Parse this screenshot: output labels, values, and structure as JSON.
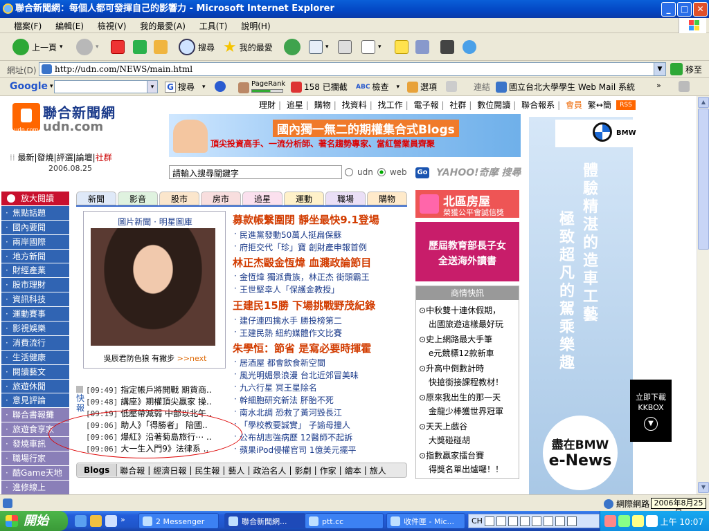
{
  "window": {
    "title": "聯合新聞網：每個人都可發揮自己的影響力 - Microsoft Internet Explorer",
    "controls": {
      "minimize": "_",
      "maximize": "□",
      "close": "✕"
    }
  },
  "menu": [
    "檔案(F)",
    "編輯(E)",
    "檢視(V)",
    "我的最愛(A)",
    "工具(T)",
    "說明(H)"
  ],
  "toolbar": {
    "back": "上一頁",
    "search": "搜尋",
    "favorites": "我的最愛"
  },
  "address": {
    "label": "網址(D)",
    "url": "http://udn.com/NEWS/main.html",
    "go": "移至"
  },
  "googlebar": {
    "brand": "Google",
    "search": "搜尋",
    "pagerank": "PageRank",
    "blocked": "158 已攔截",
    "check": "檢查",
    "options": "選項",
    "links": "連結",
    "link1": "國立台北大學學生 Web Mail 系統"
  },
  "page": {
    "logo_cn": "聯合新聞網",
    "logo_en": "udn.com",
    "logo_small": "udn.com",
    "toplinks": [
      "理財",
      "追星",
      "購物",
      "找資料",
      "找工作",
      "電子報",
      "社群",
      "數位閱讀",
      "聯合報系",
      "會員",
      "繁↔簡"
    ],
    "rss": "RSS",
    "banner": {
      "title": "國內獨一無二的期權集合式Blogs",
      "subtitle": "頂尖投資高手、一流分析師、著名趨勢專家、當紅營業員齊聚"
    },
    "quicknav": [
      "最新",
      "發燒",
      "評選",
      "論壇",
      "社群"
    ],
    "date": "2006.08.25",
    "search_value": "請輸入搜尋關鍵字",
    "radio_udn": "udn",
    "radio_web": "web",
    "go": "Go",
    "yahoo": "YAHOO!奇摩 搜尋",
    "sidebar": [
      "放大閱讀",
      "焦點話題",
      "國內要聞",
      "兩岸國際",
      "地方新聞",
      "財經產業",
      "股市理財",
      "資訊科技",
      "運動賽事",
      "影視娛樂",
      "消費流行",
      "生活健康",
      "閱讀藝文",
      "旅遊休閒",
      "意見評論",
      "聯合書報攤",
      "旅遊食享家",
      "發燒車訊",
      "職場行家",
      "酷Game天地",
      "進修線上"
    ],
    "tabs": [
      "新聞",
      "影音",
      "股市",
      "房市",
      "追星",
      "運動",
      "職場",
      "購物"
    ],
    "photo_caption": "圖片新聞 · 明星圖庫",
    "photo_sub": "吳辰君防色狼 有撇步",
    "photo_next": ">>next",
    "headlines": [
      {
        "title": "募款帳繫圍閉 靜坐最快9.1登場",
        "items": [
          "民進黨發動50萬人挺扁保蘇",
          "府拒交代「珍」寶 創財產申報首例"
        ]
      },
      {
        "title": "林正杰毆金恆煒 血濺政論節目",
        "items": [
          "金恆煒 獨派貴族，林正杰 街頭霸王",
          "王世堅幸人「保護金教授」"
        ]
      },
      {
        "title": "王建民15勝 下場挑戰野茂紀錄",
        "items": [
          "建仔連四擒水手 勝投榜第二",
          "王建民熱 紐約媒體作文比賽"
        ]
      },
      {
        "title": "朱學恒：節省 是寫必要時揮霍",
        "items": [
          "居酒屋 都會飲食新空間",
          "風光明媚景浪漫 台北近郊冒美味",
          "九六行星 冥王星除名",
          "幹細胞研究新法 肧胎不死",
          "南水北調 恐救了黃河毀長江",
          "「學校教要誠實」 子諭母撞人",
          "公布胡志強病歷 12醫師不起訴",
          "蘋果iPod侵權官司 1億美元擺平"
        ]
      }
    ],
    "kuai": "快報",
    "quicknews": [
      {
        "time": "[09:49]",
        "text": "指定帳戶將開戰 期貨商.."
      },
      {
        "time": "[09:48]",
        "text": "講座》期權頂尖贏家 操.."
      },
      {
        "time": "[09:19]",
        "text": "低壓帶減弱 中部以北午.."
      },
      {
        "time": "[09:06]",
        "text": "助人》「得勝者」 陪國.."
      },
      {
        "time": "[09:06]",
        "text": "爆紅》沿著菊島旅行⋯ .."
      },
      {
        "time": "[09:06]",
        "text": "大一生入門9》法律系 .."
      }
    ],
    "blogs": {
      "label": "Blogs",
      "links": [
        "聯合報",
        "經濟日報",
        "民生報",
        "藝人",
        "政治名人",
        "影劇",
        "作家",
        "繪本",
        "旅人"
      ]
    },
    "house": {
      "title": "北區房屋",
      "subtitle": "榮獲公平會誠信獎"
    },
    "edu_ad": [
      "歷屆教育部長子女",
      "全送海外讀書"
    ],
    "shop": {
      "head": "商情快訊",
      "items": [
        "中秋雙十連休假期，",
        "出國旅遊這樣最好玩",
        "史上網路最大手筆",
        "e元競標12款新車",
        "升高中倒數計時",
        "快搶銜接課程教材！",
        "原來我出生的那一天",
        "金龍少棒獲世界冠軍",
        "天天上戲谷",
        "大獎碰碰胡",
        "指數贏家擂台賽",
        "得獎名單出爐囉！！"
      ]
    },
    "bmw": {
      "line1": "體驗精湛的造車工藝",
      "line2": "極致超凡的駕乘樂趣",
      "circle1": "盡在BMW",
      "circle2": "e-News",
      "brand": "BMW"
    },
    "kkbox": {
      "line1": "立即下載",
      "line2": "KKBOX"
    }
  },
  "statusbar": {
    "zone": "網際網路",
    "date": "2006年8月25日"
  },
  "taskbar": {
    "start": "開始",
    "tasks": [
      "2 Messenger",
      "聯合新聞網...",
      "ptt.cc",
      "收件匣 - Mic..."
    ],
    "ime": "CH",
    "clock": "上午 10:07"
  }
}
